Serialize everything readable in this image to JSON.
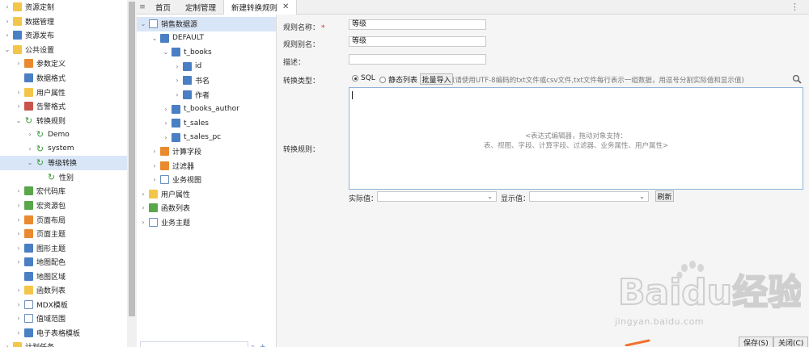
{
  "left_nav": {
    "items": [
      {
        "label": "资源定制",
        "icon": "folder-icon",
        "icon_class": "folder",
        "chevron": "›",
        "indent": 0
      },
      {
        "label": "数据管理",
        "icon": "folder-icon",
        "icon_class": "folder",
        "chevron": "›",
        "indent": 0
      },
      {
        "label": "资源发布",
        "icon": "publish-icon",
        "icon_class": "blue",
        "chevron": "›",
        "indent": 0
      },
      {
        "label": "公共设置",
        "icon": "settings-folder-icon",
        "icon_class": "folder",
        "chevron": "⌄",
        "indent": 0
      },
      {
        "label": "参数定义",
        "icon": "param-icon",
        "icon_class": "orange",
        "chevron": "›",
        "indent": 1
      },
      {
        "label": "数据格式",
        "icon": "format-icon",
        "icon_class": "blue",
        "chevron": "",
        "indent": 1
      },
      {
        "label": "用户属性",
        "icon": "user-attr-icon",
        "icon_class": "folder",
        "chevron": "›",
        "indent": 1
      },
      {
        "label": "告警格式",
        "icon": "alert-format-icon",
        "icon_class": "red",
        "chevron": "›",
        "indent": 1
      },
      {
        "label": "转换规则",
        "icon": "transform-rule-icon",
        "icon_class": "cycle",
        "chevron": "⌄",
        "indent": 1
      },
      {
        "label": "Demo",
        "icon": "transform-rule-icon",
        "icon_class": "cycle",
        "chevron": "›",
        "indent": 2
      },
      {
        "label": "system",
        "icon": "transform-rule-icon",
        "icon_class": "cycle",
        "chevron": "›",
        "indent": 2
      },
      {
        "label": "等级转换",
        "icon": "transform-rule-icon",
        "icon_class": "cycle",
        "chevron": "⌄",
        "indent": 2,
        "selected": true
      },
      {
        "label": "性别",
        "icon": "transform-rule-icon",
        "icon_class": "cycle",
        "chevron": "",
        "indent": 3
      },
      {
        "label": "宏代码库",
        "icon": "macro-icon",
        "icon_class": "green",
        "chevron": "›",
        "indent": 1
      },
      {
        "label": "宏资源包",
        "icon": "macro-package-icon",
        "icon_class": "green",
        "chevron": "›",
        "indent": 1
      },
      {
        "label": "页面布局",
        "icon": "page-layout-icon",
        "icon_class": "orange",
        "chevron": "›",
        "indent": 1
      },
      {
        "label": "页面主题",
        "icon": "page-theme-icon",
        "icon_class": "orange",
        "chevron": "›",
        "indent": 1
      },
      {
        "label": "图形主题",
        "icon": "graph-theme-icon",
        "icon_class": "blue",
        "chevron": "›",
        "indent": 1
      },
      {
        "label": "地图配色",
        "icon": "map-color-icon",
        "icon_class": "blue",
        "chevron": "›",
        "indent": 1
      },
      {
        "label": "地图区域",
        "icon": "map-region-icon",
        "icon_class": "blue",
        "chevron": "",
        "indent": 1
      },
      {
        "label": "函数列表",
        "icon": "function-list-icon",
        "icon_class": "folder",
        "chevron": "›",
        "indent": 1
      },
      {
        "label": "MDX模板",
        "icon": "mdx-template-icon",
        "icon_class": "doc",
        "chevron": "›",
        "indent": 1
      },
      {
        "label": "值域范围",
        "icon": "value-range-icon",
        "icon_class": "doc",
        "chevron": "›",
        "indent": 1
      },
      {
        "label": "电子表格模板",
        "icon": "spreadsheet-template-icon",
        "icon_class": "blue",
        "chevron": "›",
        "indent": 1
      },
      {
        "label": "计划任务",
        "icon": "schedule-icon",
        "icon_class": "folder",
        "chevron": "›",
        "indent": 0
      }
    ]
  },
  "tabs": {
    "menu_glyph": "≡",
    "items": [
      {
        "label": "首页",
        "active": false
      },
      {
        "label": "定制管理",
        "active": false
      },
      {
        "label": "新建转换规则",
        "active": true,
        "closable": true
      }
    ],
    "close_glyph": "✕",
    "more_glyph": "⋮"
  },
  "resource_tree": {
    "items": [
      {
        "label": "销售数据源",
        "icon": "datasource-icon",
        "icon_class": "doc",
        "chevron": "⌄",
        "indent": 0,
        "selected": true
      },
      {
        "label": "DEFAULT",
        "icon": "schema-icon",
        "icon_class": "blue",
        "chevron": "⌄",
        "indent": 1
      },
      {
        "label": "t_books",
        "icon": "table-icon",
        "icon_class": "blue",
        "chevron": "⌄",
        "indent": 2
      },
      {
        "label": "id",
        "icon": "field-icon",
        "icon_class": "blue",
        "chevron": "›",
        "indent": 3
      },
      {
        "label": "书名",
        "icon": "field-icon",
        "icon_class": "blue",
        "chevron": "›",
        "indent": 3
      },
      {
        "label": "作者",
        "icon": "field-icon",
        "icon_class": "blue",
        "chevron": "›",
        "indent": 3
      },
      {
        "label": "t_books_author",
        "icon": "table-icon",
        "icon_class": "blue",
        "chevron": "›",
        "indent": 2
      },
      {
        "label": "t_sales",
        "icon": "table-icon",
        "icon_class": "blue",
        "chevron": "›",
        "indent": 2
      },
      {
        "label": "t_sales_pc",
        "icon": "table-icon",
        "icon_class": "blue",
        "chevron": "›",
        "indent": 2
      },
      {
        "label": "计算字段",
        "icon": "calc-field-icon",
        "icon_class": "orange",
        "chevron": "›",
        "indent": 1
      },
      {
        "label": "过滤器",
        "icon": "filter-icon",
        "icon_class": "orange",
        "chevron": "›",
        "indent": 1
      },
      {
        "label": "业务视图",
        "icon": "business-view-icon",
        "icon_class": "doc",
        "chevron": "›",
        "indent": 1
      },
      {
        "label": "用户属性",
        "icon": "user-attr-icon",
        "icon_class": "folder",
        "chevron": "›",
        "indent": 0
      },
      {
        "label": "函数列表",
        "icon": "function-list-icon",
        "icon_class": "green",
        "chevron": "›",
        "indent": 0
      },
      {
        "label": "业务主题",
        "icon": "business-theme-icon",
        "icon_class": "doc",
        "chevron": "›",
        "indent": 0
      }
    ]
  },
  "form": {
    "rule_name_label": "规则名称：",
    "required_mark": "*",
    "rule_name_value": "等级",
    "rule_alias_label": "规则别名：",
    "rule_alias_value": "等级",
    "description_label": "描述：",
    "description_value": "",
    "convert_type_label": "转换类型：",
    "option_sql": "SQL",
    "option_static": "静态列表",
    "batch_import_label": "批量导入",
    "import_hint": "(请使用UTF-8编码的txt文件或csv文件,txt文件每行表示一组数据，用逗号分割实际值和显示值)",
    "convert_rule_label": "转换规则：",
    "editor_hint_line1": "<表达式编辑器，拖动对象支持：",
    "editor_hint_line2": "表、视图、字段、计算字段、过滤器、业务属性、用户属性>",
    "actual_value_label": "实际值：",
    "display_value_label": "显示值：",
    "refresh_label": "刷新",
    "save_label": "保存(S)",
    "close_label": "关闭(C)"
  },
  "watermark": {
    "text": "Baidu经验",
    "url": "jingyan.baidu.com"
  },
  "colors": {
    "selection": "#d9e6f7",
    "editor_border": "#8fb3dc",
    "required": "#d9242e"
  }
}
